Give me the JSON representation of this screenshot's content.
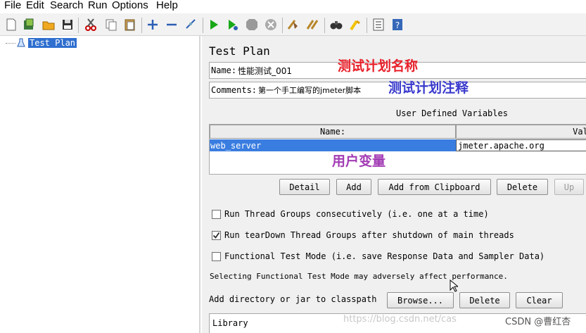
{
  "menu": [
    "File",
    "Edit",
    "Search",
    "Run",
    "Options",
    "Help"
  ],
  "toolbar": {
    "icons": [
      "new-icon",
      "templates-icon",
      "open-icon",
      "save-icon",
      "cut-icon",
      "copy-icon",
      "paste-icon",
      "expand-icon",
      "collapse-icon",
      "toggle-icon",
      "start-icon",
      "start-no-pauses-icon",
      "stop-icon",
      "shutdown-icon",
      "clear-icon",
      "clear-all-icon",
      "search-icon",
      "reset-search-icon",
      "function-helper-icon",
      "help-icon"
    ],
    "colors": {
      "start": "#18a818",
      "stop": "#9a9a9a"
    }
  },
  "tree": {
    "root_label": "Test Plan",
    "selected_color": "#2f6fcf"
  },
  "panel": {
    "title": "Test Plan",
    "name_label": "Name:",
    "name_value": "性能测试_001",
    "comments_label": "Comments:",
    "comments_value": "第一个手工编写的jmeter脚本",
    "udv_title": "User Defined Variables",
    "table": {
      "headers": [
        "Name:",
        "Valu"
      ],
      "rows": [
        {
          "name": "web_server",
          "value": "jmeter.apache.org"
        }
      ]
    },
    "buttons": {
      "detail": "Detail",
      "add": "Add",
      "add_clipboard": "Add from Clipboard",
      "delete": "Delete",
      "up": "Up"
    },
    "checkboxes": [
      {
        "label": "Run Thread Groups consecutively (i.e. one at a time)",
        "checked": false
      },
      {
        "label": "Run tearDown Thread Groups after shutdown of main threads",
        "checked": true
      },
      {
        "label": "Functional Test Mode (i.e. save Response Data and Sampler Data)",
        "checked": false
      }
    ],
    "note": "Selecting Functional Test Mode may adversely affect performance.",
    "classpath_label": "Add directory or jar to classpath",
    "classpath_buttons": {
      "browse": "Browse...",
      "delete": "Delete",
      "clear": "Clear"
    },
    "library_header": "Library"
  },
  "annotations": {
    "name_note": "测试计划名称",
    "comment_note": "测试计划注释",
    "var_note": "用户变量",
    "colors": {
      "red": "#e8202a",
      "blue": "#3a3acd",
      "purple": "#a23cb4"
    }
  },
  "watermark": {
    "url": "https://blog.csdn.net/cas",
    "author": "CSDN @曹红杏"
  }
}
